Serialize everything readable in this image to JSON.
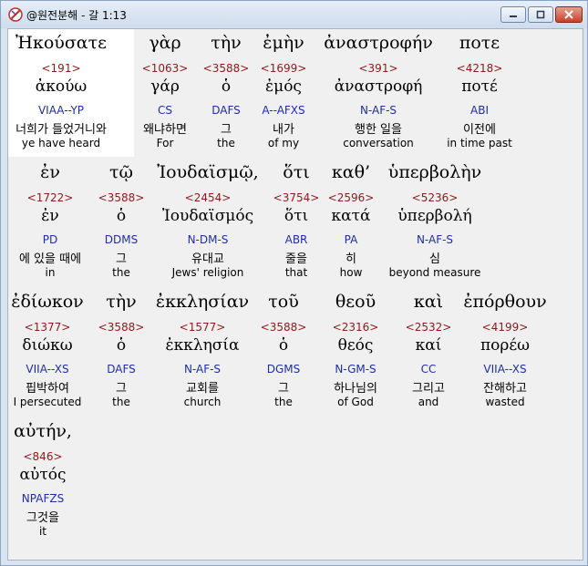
{
  "window": {
    "title": "@원전분해 - 갈 1:13",
    "minimize_glyph": "–",
    "maximize_glyph": "□",
    "close_glyph": "✕"
  },
  "colors": {
    "strong_number": "#8b1a1a",
    "morphology": "#1f2ea8",
    "highlight_background": "#ffffff"
  },
  "rows": [
    {
      "words": [
        {
          "greek": "Ἠκούσατε",
          "strong": "<191>",
          "lemma": "ἀκούω",
          "morph": "VIAA--YP",
          "korean": "너희가 들었거니와",
          "english": "ye have heard"
        },
        {
          "greek": "γὰρ",
          "strong": "<1063>",
          "lemma": "γάρ",
          "morph": "CS",
          "korean": "왜냐하면",
          "english": "For"
        },
        {
          "greek": "τὴν",
          "strong": "<3588>",
          "lemma": "ὁ",
          "morph": "DAFS",
          "korean": "그",
          "english": "the"
        },
        {
          "greek": "ἐμὴν",
          "strong": "<1699>",
          "lemma": "ἐμός",
          "morph": "A--AFXS",
          "korean": "내가",
          "english": "of my"
        },
        {
          "greek": "ἀναστροφήν",
          "strong": "<391>",
          "lemma": "ἀναστροφή",
          "morph": "N-AF-S",
          "korean": "행한 일을",
          "english": "conversation"
        },
        {
          "greek": "ποτε",
          "strong": "<4218>",
          "lemma": "ποτέ",
          "morph": "ABI",
          "korean": "이전에",
          "english": "in time past"
        }
      ]
    },
    {
      "words": [
        {
          "greek": "ἐν",
          "strong": "<1722>",
          "lemma": "ἐν",
          "morph": "PD",
          "korean": "에 있을 때에",
          "english": "in"
        },
        {
          "greek": "τῷ",
          "strong": "<3588>",
          "lemma": "ὁ",
          "morph": "DDMS",
          "korean": "그",
          "english": "the"
        },
        {
          "greek": "Ἰουδαϊσμῷ,",
          "strong": "<2454>",
          "lemma": "Ἰουδαϊσμός",
          "morph": "N-DM-S",
          "korean": "유대교",
          "english": "Jews' religion"
        },
        {
          "greek": "ὅτι",
          "strong": "<3754>",
          "lemma": "ὅτι",
          "morph": "ABR",
          "korean": "줄을",
          "english": "that"
        },
        {
          "greek": "καθ’",
          "strong": "<2596>",
          "lemma": "κατά",
          "morph": "PA",
          "korean": "히",
          "english": "how"
        },
        {
          "greek": "ὑπερβολὴν",
          "strong": "<5236>",
          "lemma": "ὑπερβολή",
          "morph": "N-AF-S",
          "korean": "심",
          "english": "beyond measure"
        }
      ]
    },
    {
      "words": [
        {
          "greek": "ἐδίωκον",
          "strong": "<1377>",
          "lemma": "διώκω",
          "morph": "VIIA--XS",
          "korean": "핍박하여",
          "english": "I persecuted"
        },
        {
          "greek": "τὴν",
          "strong": "<3588>",
          "lemma": "ὁ",
          "morph": "DAFS",
          "korean": "그",
          "english": "the"
        },
        {
          "greek": "ἐκκλησίαν",
          "strong": "<1577>",
          "lemma": "ἐκκλησία",
          "morph": "N-AF-S",
          "korean": "교회를",
          "english": "church"
        },
        {
          "greek": "τοῦ",
          "strong": "<3588>",
          "lemma": "ὁ",
          "morph": "DGMS",
          "korean": "그",
          "english": "the"
        },
        {
          "greek": "θεοῦ",
          "strong": "<2316>",
          "lemma": "θεός",
          "morph": "N-GM-S",
          "korean": "하나님의",
          "english": "of God"
        },
        {
          "greek": "καὶ",
          "strong": "<2532>",
          "lemma": "καί",
          "morph": "CC",
          "korean": "그리고",
          "english": "and"
        },
        {
          "greek": "ἐπόρθουν",
          "strong": "<4199>",
          "lemma": "πορέω",
          "morph": "VIIA--XS",
          "korean": "잔해하고",
          "english": "wasted"
        }
      ]
    },
    {
      "words": [
        {
          "greek": "αὐτήν,",
          "strong": "<846>",
          "lemma": "αὐτός",
          "morph": "NPAFZS",
          "korean": "그것을",
          "english": "it"
        }
      ]
    }
  ]
}
